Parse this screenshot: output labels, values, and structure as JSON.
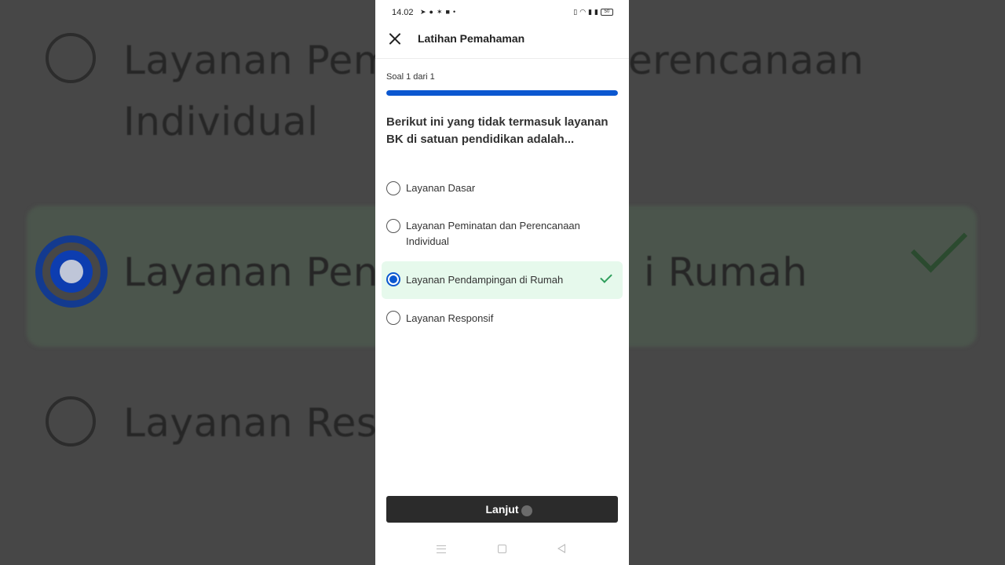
{
  "status_bar": {
    "time": "14.02",
    "left_icons": [
      "telegram-icon",
      "incognito-icon",
      "app-icon",
      "app-icon",
      "dot-icon"
    ],
    "right_icons": [
      "vibrate-icon",
      "speed-icon",
      "wifi-icon",
      "signal-icon",
      "signal-icon"
    ],
    "battery": "50"
  },
  "app_bar": {
    "title": "Latihan Pemahaman",
    "close_icon": "close-icon"
  },
  "progress": {
    "label": "Soal 1 dari 1",
    "fraction": 1.0
  },
  "question": "Berikut ini yang tidak termasuk layanan BK di satuan pendidikan adalah...",
  "options": [
    {
      "label": "Layanan Dasar",
      "selected": false,
      "correct": false
    },
    {
      "label": "Layanan Peminatan dan Perencanaan Individual",
      "selected": false,
      "correct": false
    },
    {
      "label": "Layanan Pendampingan di Rumah",
      "selected": true,
      "correct": true
    },
    {
      "label": "Layanan Responsif",
      "selected": false,
      "correct": false
    }
  ],
  "next_button": {
    "label": "Lanjut"
  },
  "background_zoom": {
    "row1_line1": "Layanan Pem",
    "row1_line1b": "erencanaan",
    "row1_line2": "Individual",
    "row2": "Layanan Pen",
    "row2b": "i Rumah",
    "row3": "Layanan Res"
  },
  "colors": {
    "accent": "#0b57d0",
    "selected_bg": "#e6f9ec",
    "check": "#2e9e5b",
    "button_bg": "#2b2b2b"
  }
}
